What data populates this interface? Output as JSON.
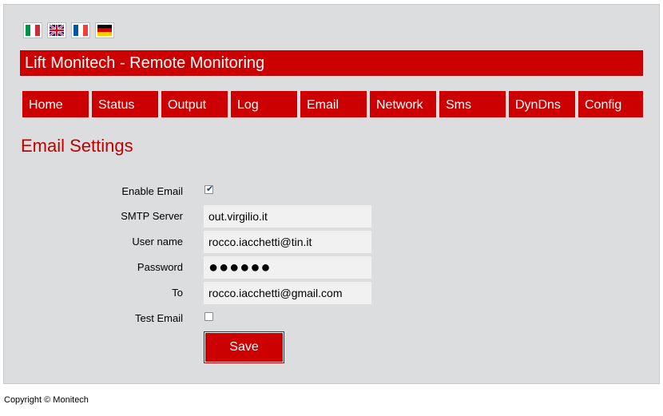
{
  "flags": [
    {
      "name": "italian-flag-icon",
      "colors": [
        "#009246",
        "#ffffff",
        "#ce2b37"
      ]
    },
    {
      "name": "uk-flag-icon",
      "colors": [
        "#012169",
        "#ffffff",
        "#c8102e"
      ]
    },
    {
      "name": "french-flag-icon",
      "colors": [
        "#0055a4",
        "#ffffff",
        "#ef4135"
      ]
    },
    {
      "name": "german-flag-icon",
      "colors": [
        "#000000",
        "#dd0000",
        "#ffce00"
      ]
    }
  ],
  "header": {
    "title": "Lift Monitech - Remote Monitoring"
  },
  "nav": {
    "items": [
      "Home",
      "Status",
      "Output",
      "Log",
      "Email",
      "Network",
      "Sms",
      "DynDns",
      "Config"
    ]
  },
  "page": {
    "heading": "Email Settings"
  },
  "form": {
    "enable_email_label": "Enable Email",
    "enable_email_checked": true,
    "smtp_label": "SMTP Server",
    "smtp_value": "out.virgilio.it",
    "username_label": "User name",
    "username_value": "rocco.iacchetti@tin.it",
    "password_label": "Password",
    "password_mask": "●●●●●●",
    "to_label": "To",
    "to_value": "rocco.iacchetti@gmail.com",
    "test_email_label": "Test Email",
    "test_email_checked": false,
    "save_label": "Save"
  },
  "footer": {
    "copyright": "Copyright © Monitech"
  },
  "colors": {
    "accent": "#cc0000",
    "panel": "#dcdddf",
    "heading": "#c00000"
  }
}
